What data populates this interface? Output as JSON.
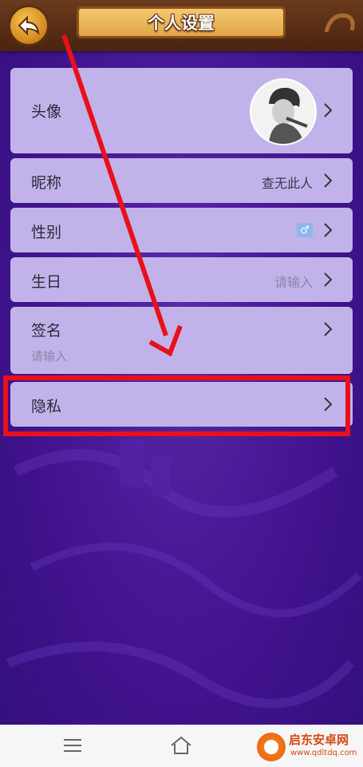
{
  "header": {
    "title": "个人设置",
    "back_icon": "back-arrow-icon"
  },
  "rows": {
    "avatar": {
      "label": "头像"
    },
    "nickname": {
      "label": "昵称",
      "value": "查无此人"
    },
    "gender": {
      "label": "性别",
      "value": "♂"
    },
    "birthday": {
      "label": "生日",
      "placeholder": "请输入"
    },
    "signature": {
      "label": "签名",
      "placeholder": "请输入"
    },
    "privacy": {
      "label": "隐私"
    }
  },
  "navbar": {
    "menu_icon": "menu-icon",
    "home_icon": "home-icon"
  },
  "watermark": {
    "title": "启东安卓网",
    "url": "www.qdltdq.com"
  },
  "colors": {
    "background": "#4a1a99",
    "row": "#c1b3ea",
    "annotation": "#e8101a",
    "header": "#6a3a1c",
    "title_plate": "#f4c870"
  }
}
